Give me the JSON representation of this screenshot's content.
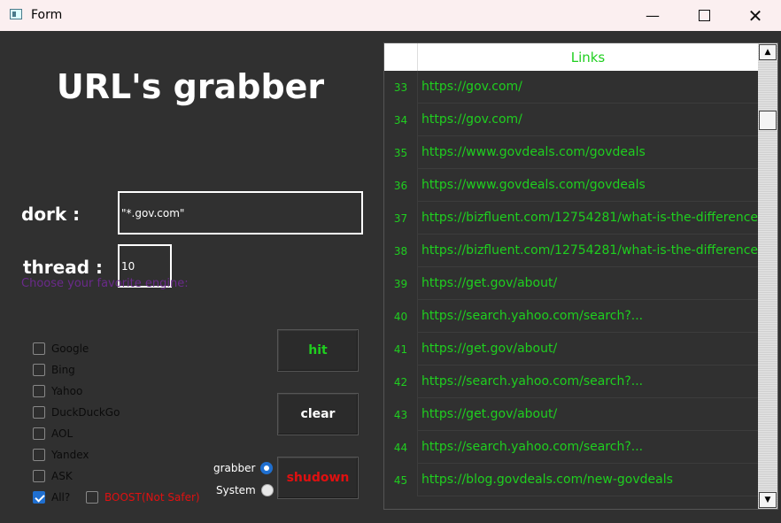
{
  "window": {
    "title": "Form"
  },
  "main_title": "URL's grabber",
  "dork": {
    "label": "dork    :",
    "value": "\"*.gov.com\""
  },
  "thread": {
    "label": "thread :",
    "value": "10"
  },
  "hint": "Choose your favorite engine:",
  "engines": [
    {
      "label": "Google",
      "checked": false
    },
    {
      "label": "Bing",
      "checked": false
    },
    {
      "label": "Yahoo",
      "checked": false
    },
    {
      "label": "DuckDuckGo",
      "checked": false
    },
    {
      "label": "AOL",
      "checked": false
    },
    {
      "label": "Yandex",
      "checked": false
    },
    {
      "label": "ASK",
      "checked": false
    },
    {
      "label": "All?",
      "checked": true
    }
  ],
  "boost": {
    "label": "BOOST(Not Safer)",
    "checked": false
  },
  "buttons": {
    "hit": "hit",
    "clear": "clear",
    "shutdown": "shudown"
  },
  "modes": [
    {
      "label": "grabber",
      "selected": true
    },
    {
      "label": "System",
      "selected": false
    }
  ],
  "table": {
    "header": "Links",
    "rows": [
      {
        "num": "33",
        "url": "https://gov.com/"
      },
      {
        "num": "34",
        "url": "https://gov.com/"
      },
      {
        "num": "35",
        "url": "https://www.govdeals.com/govdeals"
      },
      {
        "num": "36",
        "url": "https://www.govdeals.com/govdeals"
      },
      {
        "num": "37",
        "url": "https://bizfluent.com/12754281/what-is-the-difference..."
      },
      {
        "num": "38",
        "url": "https://bizfluent.com/12754281/what-is-the-difference..."
      },
      {
        "num": "39",
        "url": "https://get.gov/about/"
      },
      {
        "num": "40",
        "url": "https://search.yahoo.com/search?..."
      },
      {
        "num": "41",
        "url": "https://get.gov/about/"
      },
      {
        "num": "42",
        "url": "https://search.yahoo.com/search?..."
      },
      {
        "num": "43",
        "url": "https://get.gov/about/"
      },
      {
        "num": "44",
        "url": "https://search.yahoo.com/search?..."
      },
      {
        "num": "45",
        "url": "https://blog.govdeals.com/new-govdeals"
      }
    ]
  },
  "colors": {
    "accent_green": "#1fcf1f",
    "shutdown_red": "#e01010",
    "hint_purple": "#6a2a8a",
    "checkbox_blue": "#1f6fd0"
  }
}
